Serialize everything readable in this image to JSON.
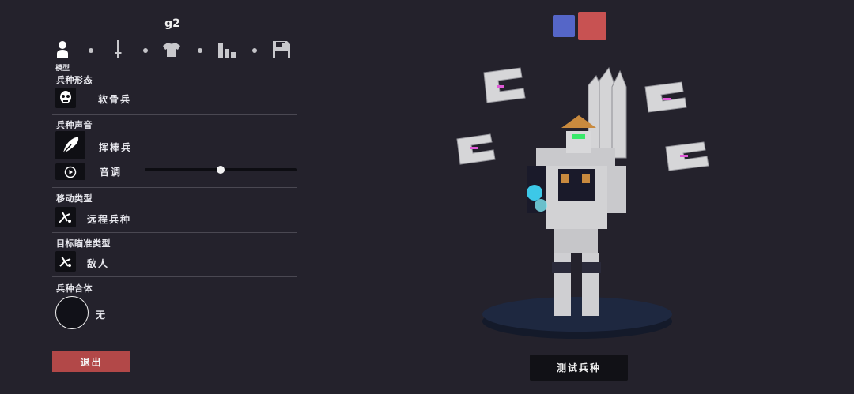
{
  "unit": {
    "name": "g2"
  },
  "tabs": [
    {
      "name": "model",
      "caption": "模型",
      "icon": "person-icon",
      "active": true
    },
    {
      "name": "weapon",
      "icon": "sword-icon"
    },
    {
      "name": "clothing",
      "icon": "shirt-icon"
    },
    {
      "name": "stats",
      "icon": "bar-chart-icon"
    },
    {
      "name": "save",
      "icon": "floppy-disk-icon"
    }
  ],
  "sections": {
    "form": {
      "label": "兵种形态",
      "value": "软骨兵",
      "icon": "skull-mask-icon"
    },
    "voice": {
      "label": "兵种声音",
      "value": "挥棒兵",
      "icon": "feather-icon",
      "pitch_label": "音调",
      "pitch_value": 0.5,
      "play_icon": "play-icon"
    },
    "movement": {
      "label": "移动类型",
      "value": "远程兵种",
      "icon": "ranged-pose-icon"
    },
    "targeting": {
      "label": "目标瞄准类型",
      "value": "敌人",
      "icon": "target-pose-icon"
    },
    "fusion": {
      "label": "兵种合体",
      "value": "无"
    }
  },
  "buttons": {
    "exit": "退出",
    "test": "测试兵种"
  },
  "teams": {
    "blue": "#5566c8",
    "red": "#c85252"
  },
  "colors": {
    "background": "#24222c",
    "exit": "#b24848",
    "pedestal": "#1e2840"
  }
}
